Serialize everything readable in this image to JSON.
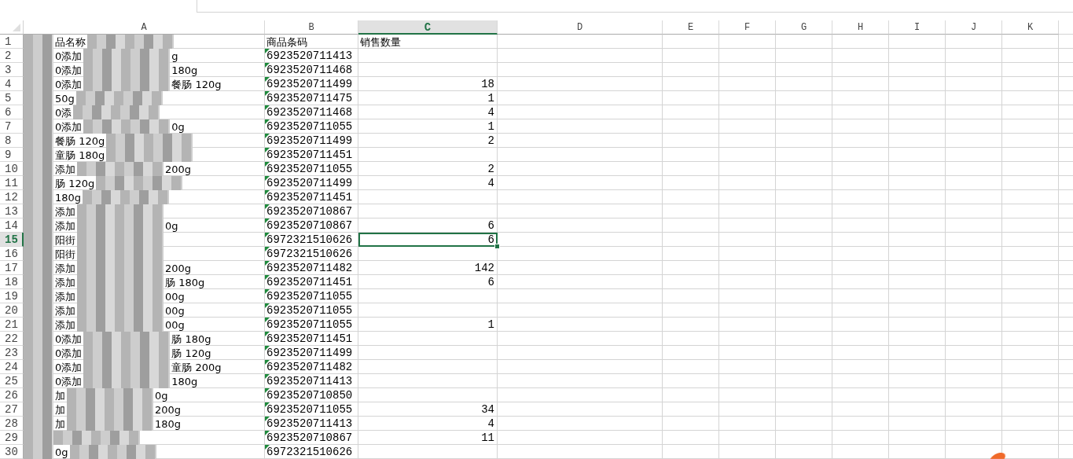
{
  "columns": [
    {
      "label": "A",
      "selected": false
    },
    {
      "label": "B",
      "selected": false
    },
    {
      "label": "C",
      "selected": true
    },
    {
      "label": "D",
      "selected": false
    },
    {
      "label": "E",
      "selected": false
    },
    {
      "label": "F",
      "selected": false
    },
    {
      "label": "G",
      "selected": false
    },
    {
      "label": "H",
      "selected": false
    },
    {
      "label": "I",
      "selected": false
    },
    {
      "label": "J",
      "selected": false
    },
    {
      "label": "K",
      "selected": false
    }
  ],
  "rows": [
    {
      "number": "1",
      "selected": false,
      "a": [
        "品名称"
      ],
      "b": "商品条码",
      "b_flagged": false,
      "c": "销售数量"
    },
    {
      "number": "2",
      "selected": false,
      "a": [
        "0添加",
        "g"
      ],
      "b": "6923520711413",
      "b_flagged": true
    },
    {
      "number": "3",
      "selected": false,
      "a": [
        "0添加",
        "180g"
      ],
      "b": "6923520711468",
      "b_flagged": true
    },
    {
      "number": "4",
      "selected": false,
      "a": [
        "0添加",
        "餐肠 120g"
      ],
      "b": "6923520711499",
      "b_flagged": true,
      "c": "18"
    },
    {
      "number": "5",
      "selected": false,
      "a": [
        "50g"
      ],
      "b": "6923520711475",
      "b_flagged": true,
      "c": "1"
    },
    {
      "number": "6",
      "selected": false,
      "a": [
        "0添"
      ],
      "b": "6923520711468",
      "b_flagged": true,
      "c": "4"
    },
    {
      "number": "7",
      "selected": false,
      "a": [
        "0添加",
        "0g"
      ],
      "b": "6923520711055",
      "b_flagged": true,
      "c": "1"
    },
    {
      "number": "8",
      "selected": false,
      "a": [
        "餐肠 120g"
      ],
      "b": "6923520711499",
      "b_flagged": true,
      "c": "2"
    },
    {
      "number": "9",
      "selected": false,
      "a": [
        "童肠 180g"
      ],
      "b": "6923520711451",
      "b_flagged": true
    },
    {
      "number": "10",
      "selected": false,
      "a": [
        "添加",
        "200g"
      ],
      "b": "6923520711055",
      "b_flagged": true,
      "c": "2"
    },
    {
      "number": "11",
      "selected": false,
      "a": [
        "肠 120g"
      ],
      "b": "6923520711499",
      "b_flagged": true,
      "c": "4"
    },
    {
      "number": "12",
      "selected": false,
      "a": [
        "180g"
      ],
      "b": "6923520711451",
      "b_flagged": true
    },
    {
      "number": "13",
      "selected": false,
      "a": [
        "添加"
      ],
      "b": "6923520710867",
      "b_flagged": true
    },
    {
      "number": "14",
      "selected": false,
      "a": [
        "添加",
        "0g"
      ],
      "b": "6923520710867",
      "b_flagged": true,
      "c": "6"
    },
    {
      "number": "15",
      "selected": true,
      "a": [
        "阳街"
      ],
      "b": "6972321510626",
      "b_flagged": true,
      "c": "6"
    },
    {
      "number": "16",
      "selected": false,
      "a": [
        "阳街"
      ],
      "b": "6972321510626",
      "b_flagged": true
    },
    {
      "number": "17",
      "selected": false,
      "a": [
        "添加",
        "200g"
      ],
      "b": "6923520711482",
      "b_flagged": true,
      "c": "142"
    },
    {
      "number": "18",
      "selected": false,
      "a": [
        "添加",
        "肠 180g"
      ],
      "b": "6923520711451",
      "b_flagged": true,
      "c": "6"
    },
    {
      "number": "19",
      "selected": false,
      "a": [
        "添加",
        "00g"
      ],
      "b": "6923520711055",
      "b_flagged": true
    },
    {
      "number": "20",
      "selected": false,
      "a": [
        "添加",
        "00g"
      ],
      "b": "6923520711055",
      "b_flagged": true
    },
    {
      "number": "21",
      "selected": false,
      "a": [
        "添加",
        "00g"
      ],
      "b": "6923520711055",
      "b_flagged": true,
      "c": "1"
    },
    {
      "number": "22",
      "selected": false,
      "a": [
        "0添加",
        "肠 180g"
      ],
      "b": "6923520711451",
      "b_flagged": true
    },
    {
      "number": "23",
      "selected": false,
      "a": [
        "0添加",
        "肠 120g"
      ],
      "b": "6923520711499",
      "b_flagged": true
    },
    {
      "number": "24",
      "selected": false,
      "a": [
        "0添加",
        "童肠 200g"
      ],
      "b": "6923520711482",
      "b_flagged": true
    },
    {
      "number": "25",
      "selected": false,
      "a": [
        "0添加",
        "180g"
      ],
      "b": "6923520711413",
      "b_flagged": true
    },
    {
      "number": "26",
      "selected": false,
      "a": [
        "加",
        "0g"
      ],
      "b": "6923520710850",
      "b_flagged": true
    },
    {
      "number": "27",
      "selected": false,
      "a": [
        "加",
        "200g"
      ],
      "b": "6923520711055",
      "b_flagged": true,
      "c": "34"
    },
    {
      "number": "28",
      "selected": false,
      "a": [
        "加",
        "180g"
      ],
      "b": "6923520711413",
      "b_flagged": true,
      "c": "4"
    },
    {
      "number": "29",
      "selected": false,
      "a": [],
      "b": "6923520710867",
      "b_flagged": true,
      "c": "11"
    },
    {
      "number": "30",
      "selected": false,
      "a": [
        "0g"
      ],
      "b": "6972321510626",
      "b_flagged": true
    }
  ]
}
